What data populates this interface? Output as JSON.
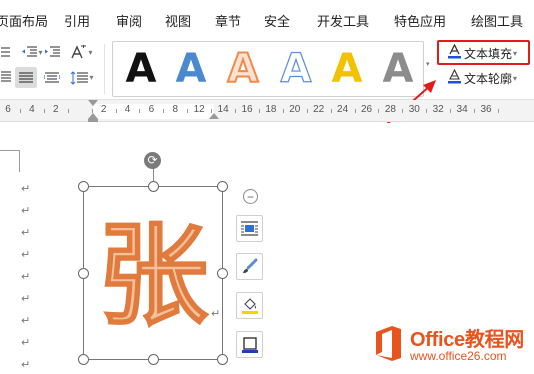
{
  "menu": {
    "items": [
      "页面布局",
      "引用",
      "审阅",
      "视图",
      "章节",
      "安全",
      "开发工具",
      "特色应用",
      "绘图工具"
    ]
  },
  "ribbon": {
    "wordart_gallery": {
      "letter": "A",
      "colors": [
        "#111111",
        "#4a88cf",
        "#f08a4b",
        "#5b8ed6",
        "#f2c200",
        "#888888"
      ]
    },
    "text_fill": {
      "label": "文本填充",
      "icon": "text-fill-icon",
      "accent": "#1f4fd8"
    },
    "text_outline": {
      "label": "文本轮廓",
      "icon": "text-outline-icon",
      "accent": "#1f4fd8"
    },
    "highlight_color": "#e21b1b"
  },
  "ruler": {
    "labels": [
      "6",
      "4",
      "2",
      "",
      "2",
      "4",
      "6",
      "8",
      "12",
      "14",
      "16",
      "18",
      "20",
      "22",
      "24",
      "26",
      "28",
      "30",
      "32",
      "34",
      "36"
    ]
  },
  "document": {
    "paragraph_mark": "↵",
    "wordart_text": "张",
    "wordart_fill": "#f4c09c",
    "wordart_outline": "#e07a3d"
  },
  "float_toolbar": {
    "buttons": [
      "wrap-text-icon",
      "shape-style-brush-icon",
      "fill-bucket-icon",
      "outline-icon"
    ]
  },
  "watermark": {
    "title": "Office教程网",
    "url": "www.office26.com",
    "brand_color": "#e8541e"
  }
}
